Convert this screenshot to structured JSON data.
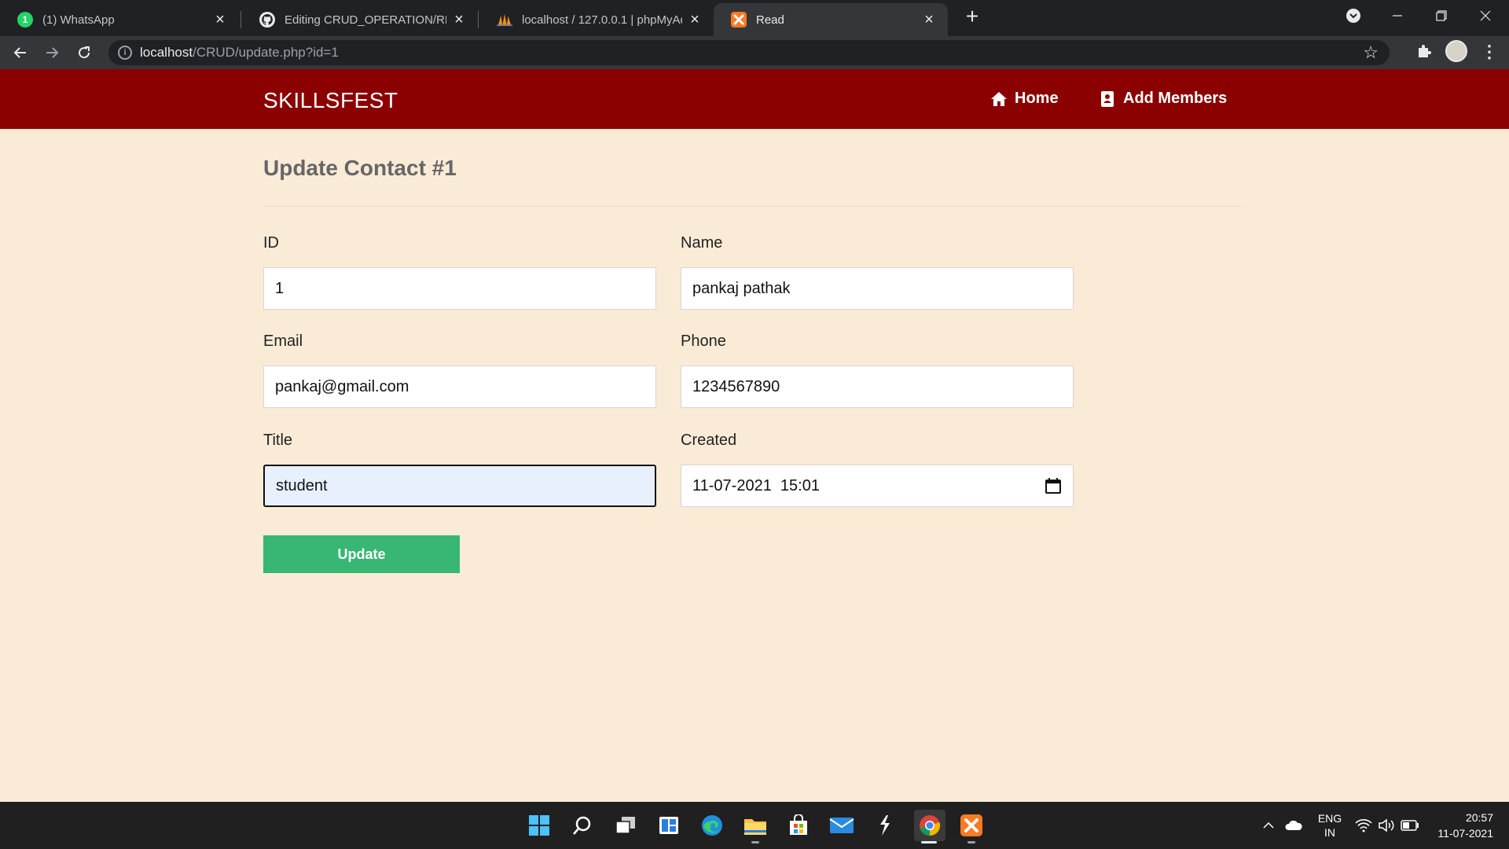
{
  "browser": {
    "tabs": [
      {
        "title": "(1) WhatsApp",
        "active": false
      },
      {
        "title": "Editing CRUD_OPERATION/READ",
        "active": false
      },
      {
        "title": "localhost / 127.0.0.1 | phpMyAdm",
        "active": false
      },
      {
        "title": "Read",
        "active": true
      }
    ],
    "url_host": "localhost",
    "url_path": "/CRUD/update.php?id=1"
  },
  "navbar": {
    "brand": "SKILLSFEST",
    "links": [
      {
        "label": "Home",
        "icon": "home-icon"
      },
      {
        "label": "Add Members",
        "icon": "address-book-icon"
      }
    ]
  },
  "form": {
    "heading": "Update Contact #1",
    "fields": {
      "id": {
        "label": "ID",
        "value": "1"
      },
      "name": {
        "label": "Name",
        "value": "pankaj pathak"
      },
      "email": {
        "label": "Email",
        "value": "pankaj@gmail.com"
      },
      "phone": {
        "label": "Phone",
        "value": "1234567890"
      },
      "title": {
        "label": "Title",
        "value": "student"
      },
      "created": {
        "label": "Created",
        "value": "11-07-2021  15:01"
      }
    },
    "submit_label": "Update"
  },
  "taskbar": {
    "language": "ENG",
    "region": "IN",
    "time": "20:57",
    "date": "11-07-2021"
  },
  "colors": {
    "navbar": "#8b0000",
    "page_background": "#faebd7",
    "button": "#38b673"
  }
}
